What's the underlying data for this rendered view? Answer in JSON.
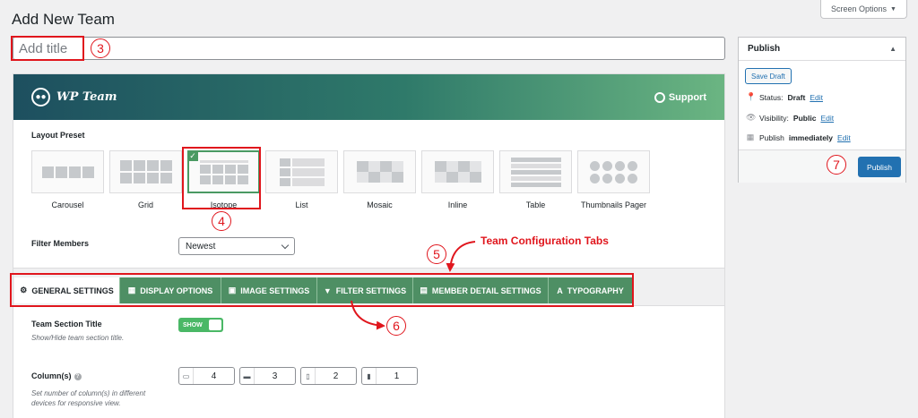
{
  "page": {
    "title": "Add New Team",
    "screen_options_label": "Screen Options",
    "title_placeholder": "Add title"
  },
  "banner": {
    "logo_text": "WP Team",
    "support_label": "Support"
  },
  "layout_preset": {
    "label": "Layout Preset",
    "selected": "Isotope",
    "items": [
      {
        "label": "Carousel",
        "icon": "carousel-preview-icon"
      },
      {
        "label": "Grid",
        "icon": "grid-preview-icon"
      },
      {
        "label": "Isotope",
        "icon": "isotope-preview-icon"
      },
      {
        "label": "List",
        "icon": "list-preview-icon"
      },
      {
        "label": "Mosaic",
        "icon": "mosaic-preview-icon"
      },
      {
        "label": "Inline",
        "icon": "inline-preview-icon"
      },
      {
        "label": "Table",
        "icon": "table-preview-icon"
      },
      {
        "label": "Thumbnails Pager",
        "icon": "thumbnails-preview-icon"
      }
    ]
  },
  "filter_members": {
    "label": "Filter Members",
    "value": "Newest"
  },
  "tabs": [
    {
      "label": "GENERAL SETTINGS",
      "icon": "gear-icon",
      "active": true
    },
    {
      "label": "DISPLAY OPTIONS",
      "icon": "grid-icon",
      "active": false
    },
    {
      "label": "IMAGE SETTINGS",
      "icon": "image-icon",
      "active": false
    },
    {
      "label": "FILTER SETTINGS",
      "icon": "filter-icon",
      "active": false
    },
    {
      "label": "MEMBER DETAIL SETTINGS",
      "icon": "id-card-icon",
      "active": false
    },
    {
      "label": "TYPOGRAPHY",
      "icon": "font-icon",
      "active": false
    }
  ],
  "team_section_title": {
    "label": "Team Section Title",
    "description": "Show/Hide team section title.",
    "toggle_label": "SHOW"
  },
  "columns": {
    "label": "Column(s)",
    "description": "Set number of column(s) in different devices for responsive view.",
    "values": [
      {
        "device": "desktop-icon",
        "value": "4"
      },
      {
        "device": "laptop-icon",
        "value": "3"
      },
      {
        "device": "tablet-icon",
        "value": "2"
      },
      {
        "device": "mobile-icon",
        "value": "1"
      }
    ]
  },
  "publish": {
    "title": "Publish",
    "save_draft": "Save Draft",
    "status_label": "Status:",
    "status_value": "Draft",
    "visibility_label": "Visibility:",
    "visibility_value": "Public",
    "schedule_label": "Publish",
    "schedule_value": "immediately",
    "edit_label": "Edit",
    "publish_button": "Publish"
  },
  "annotations": {
    "callout_title": "3",
    "callout_preset": "4",
    "callout_tabs": "5",
    "callout_filter": "6",
    "callout_publish": "7",
    "tabs_label": "Team Configuration Tabs",
    "color": "#e0161d"
  },
  "colors": {
    "accent_green": "#4e8f64",
    "wp_blue": "#2271b1",
    "toggle_green": "#4ab866"
  }
}
